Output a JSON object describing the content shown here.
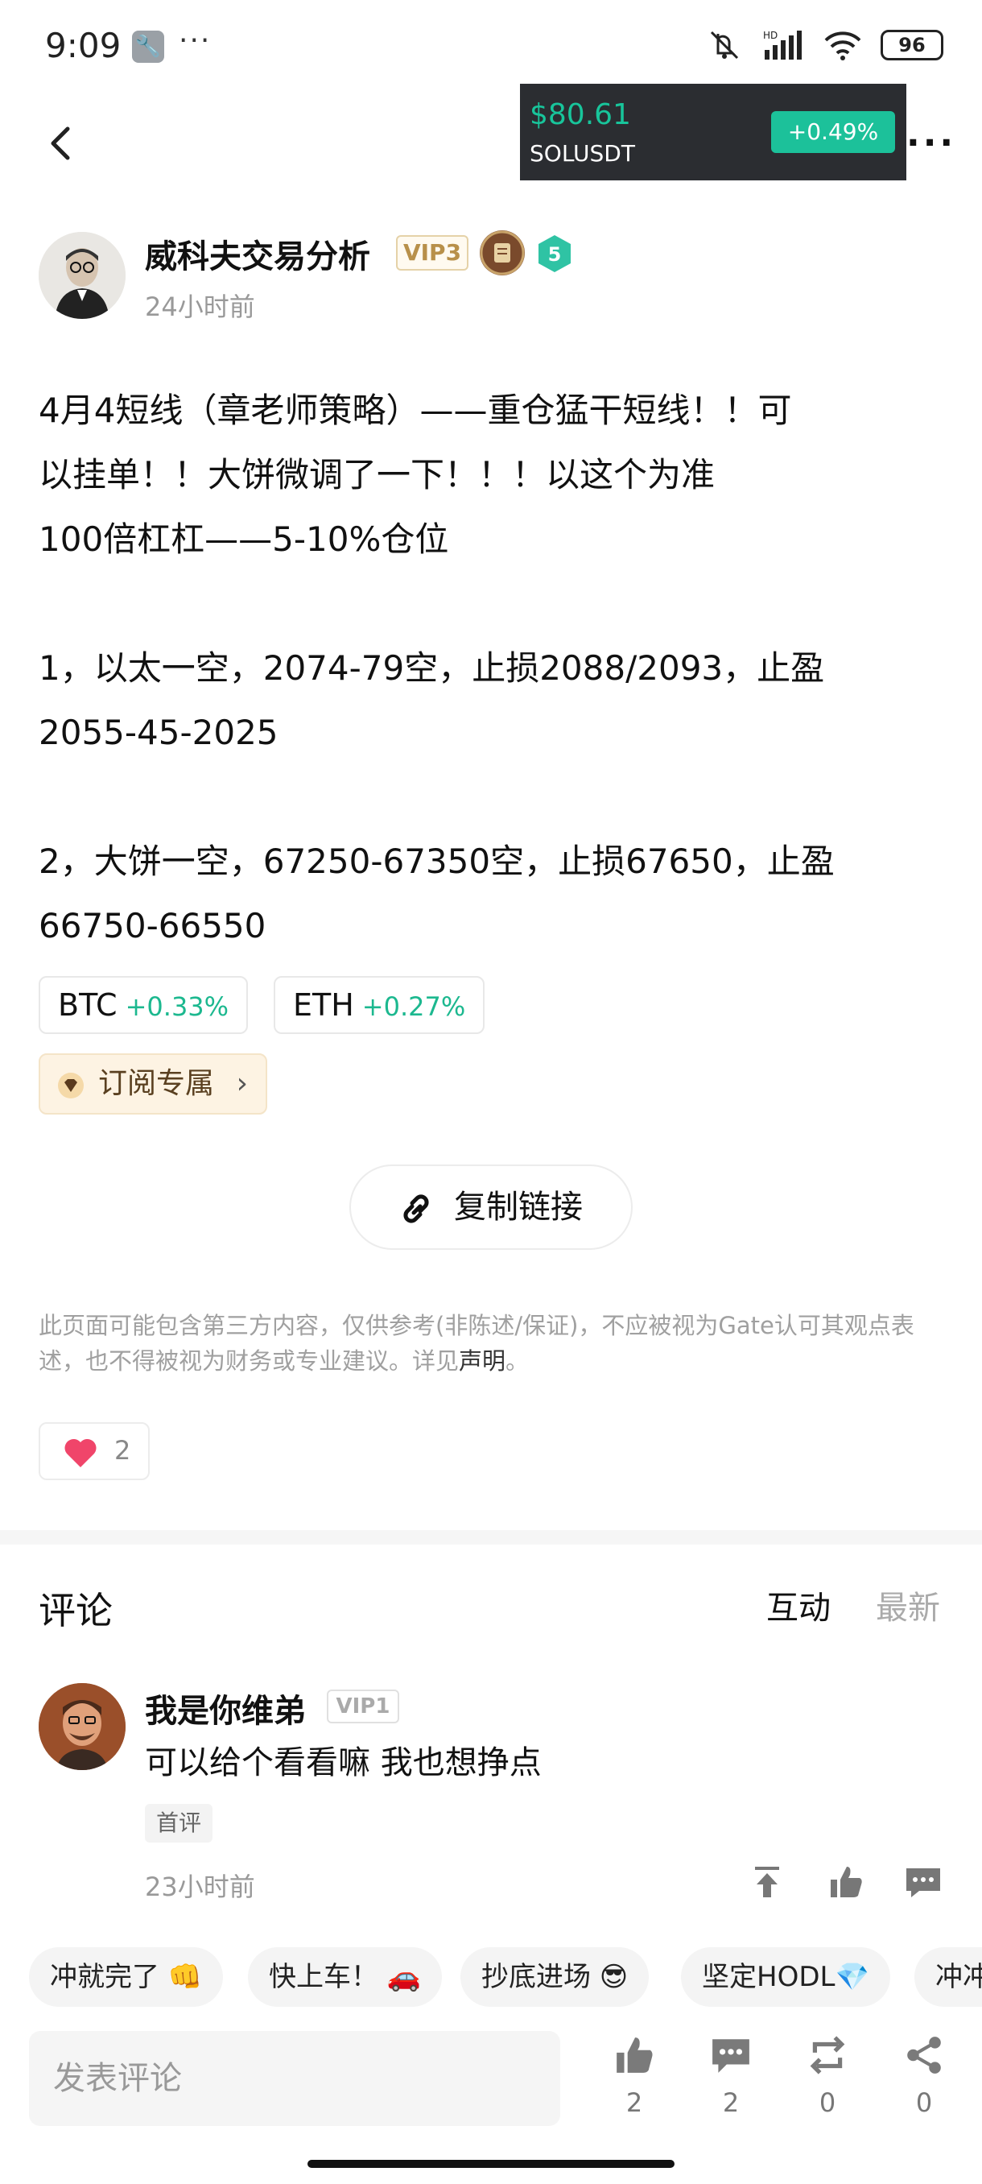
{
  "status_bar": {
    "time": "9:09",
    "battery": "96",
    "more": "···"
  },
  "ticker": {
    "price": "$80.61",
    "symbol": "SOLUSDT",
    "change": "+0.49%"
  },
  "author": {
    "name": "威科夫交易分析",
    "vip": "VIP3",
    "level": "5",
    "time": "24小时前"
  },
  "post": {
    "content": "4月4短线（章老师策略）——重仓猛干短线！！可\n以挂单！！大饼微调了一下！！！以这个为准\n100倍杠杠——5-10%仓位\n\n1，以太一空，2074-79空，止损2088/2093，止盈\n2055-45-2025\n\n2，大饼一空，67250-67350空，止损67650，止盈\n66750-66550"
  },
  "coins": [
    {
      "symbol": "BTC",
      "change": "+0.33%"
    },
    {
      "symbol": "ETH",
      "change": "+0.27%"
    }
  ],
  "subscribe_label": "订阅专属",
  "copy_link_label": "复制链接",
  "disclaimer": {
    "text": "此页面可能包含第三方内容，仅供参考(非陈述/保证)，不应被视为Gate认可其观点表述，也不得被视为财务或专业建议。详见",
    "link": "声明",
    "end": "。"
  },
  "likes": "2",
  "comments_section": {
    "title": "评论",
    "tabs": [
      "互动",
      "最新"
    ],
    "items": [
      {
        "name": "我是你维弟",
        "vip": "VIP1",
        "text": "可以给个看看嘛 我也想挣点",
        "tag": "首评",
        "time": "23小时前"
      }
    ]
  },
  "quick_replies": [
    "冲就完了 👊",
    "快上车！ 🚗",
    "抄底进场 😎",
    "坚定HODL💎",
    "冲冲"
  ],
  "bottom_bar": {
    "placeholder": "发表评论",
    "like_count": "2",
    "comment_count": "2",
    "repost_count": "0",
    "share_count": "0"
  },
  "colors": {
    "accent_green": "#1cc19a",
    "ticker_bg": "#2b2d31",
    "vip_gold": "#b8904a"
  }
}
